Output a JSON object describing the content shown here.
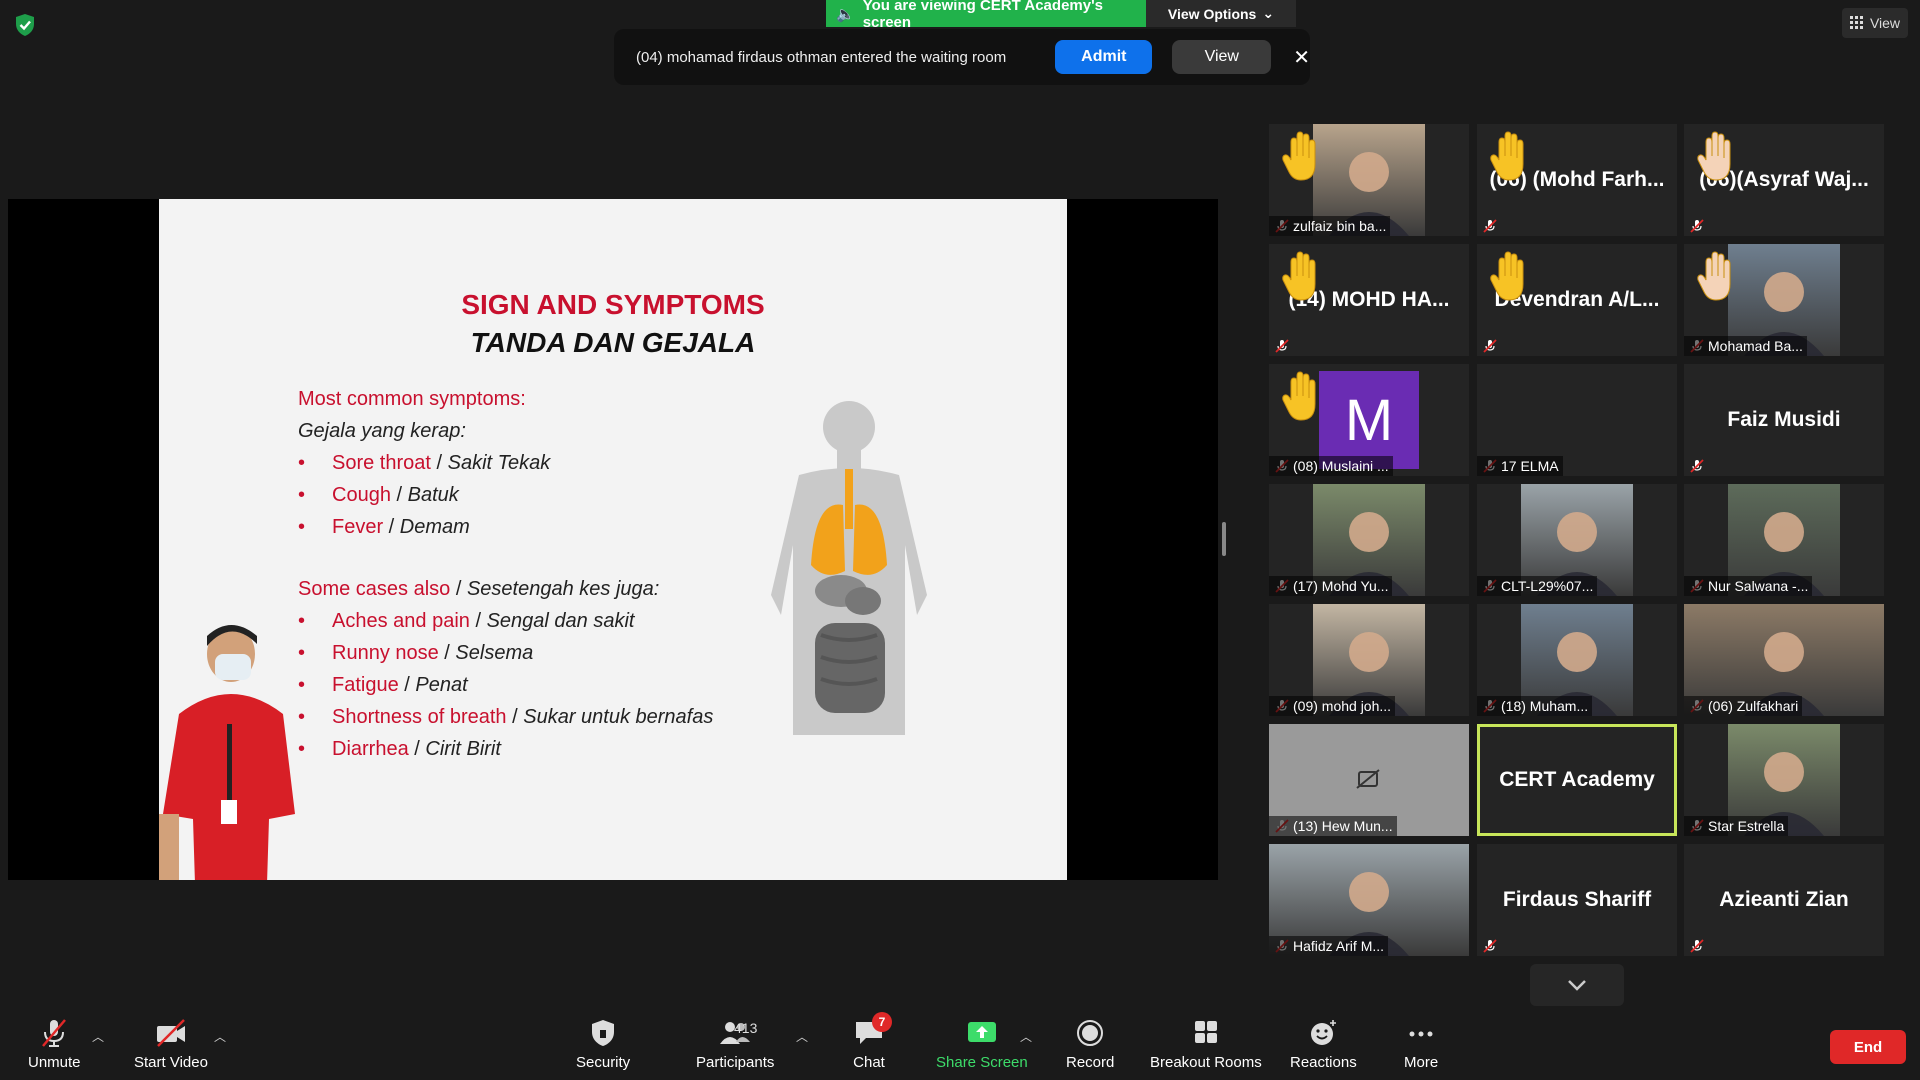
{
  "top": {
    "viewing_banner": "You are viewing CERT Academy's screen",
    "view_options": "View Options",
    "view_button": "View"
  },
  "waiting_room": {
    "message": "(04) mohamad firdaus othman entered the waiting room",
    "admit": "Admit",
    "view": "View",
    "close": "✕"
  },
  "slide": {
    "title": "SIGN AND SYMPTOMS",
    "subtitle": "TANDA DAN GEJALA",
    "common_heading": "Most common symptoms:",
    "common_heading_ms": "Gejala yang kerap:",
    "common": [
      {
        "en": "Sore throat",
        "ms": "Sakit Tekak"
      },
      {
        "en": "Cough",
        "ms": "Batuk"
      },
      {
        "en": "Fever",
        "ms": "Demam"
      }
    ],
    "some_heading": "Some cases also",
    "some_heading_ms": "Sesetengah kes juga:",
    "some": [
      {
        "en": "Aches and pain",
        "ms": "Sengal dan sakit"
      },
      {
        "en": "Runny nose",
        "ms": "Selsema"
      },
      {
        "en": "Fatigue",
        "ms": "Penat"
      },
      {
        "en": "Shortness of breath",
        "ms": "Sukar untuk bernafas"
      },
      {
        "en": "Diarrhea",
        "ms": "Cirit Birit"
      }
    ]
  },
  "gallery": [
    {
      "label": "zulfaiz bin ba...",
      "big": "",
      "hand": true
    },
    {
      "label": "",
      "big": "(06) (Mohd Farh...",
      "hand": true
    },
    {
      "label": "",
      "big": "(06)(Asyraf Waj...",
      "hand": true
    },
    {
      "label": "",
      "big": "(14) MOHD HA...",
      "hand": true
    },
    {
      "label": "",
      "big": "Devendran A/L...",
      "hand": true
    },
    {
      "label": "Mohamad Ba...",
      "big": "",
      "hand": true
    },
    {
      "label": "(08) Muslaini ...",
      "big": "",
      "hand": true,
      "avatar": "M"
    },
    {
      "label": "17 ELMA",
      "big": ""
    },
    {
      "label": "",
      "big": "Faiz Musidi"
    },
    {
      "label": "(17) Mohd Yu...",
      "big": ""
    },
    {
      "label": "CLT-L29%07...",
      "big": ""
    },
    {
      "label": "Nur Salwana -...",
      "big": ""
    },
    {
      "label": "(09) mohd joh...",
      "big": ""
    },
    {
      "label": "(18) Muham...",
      "big": ""
    },
    {
      "label": "(06) Zulfakhari",
      "big": ""
    },
    {
      "label": "(13) Hew Mun...",
      "big": ""
    },
    {
      "label": "",
      "big": "CERT Academy",
      "active": true
    },
    {
      "label": "Star Estrella",
      "big": ""
    },
    {
      "label": "Hafidz Arif M...",
      "big": ""
    },
    {
      "label": "",
      "big": "Firdaus Shariff"
    },
    {
      "label": "",
      "big": "Azieanti Zian"
    }
  ],
  "toolbar": {
    "unmute": "Unmute",
    "start_video": "Start Video",
    "security": "Security",
    "participants": "Participants",
    "participants_count": "413",
    "chat": "Chat",
    "chat_badge": "7",
    "share_screen": "Share Screen",
    "record": "Record",
    "breakout_rooms": "Breakout Rooms",
    "reactions": "Reactions",
    "more": "More",
    "end": "End"
  }
}
